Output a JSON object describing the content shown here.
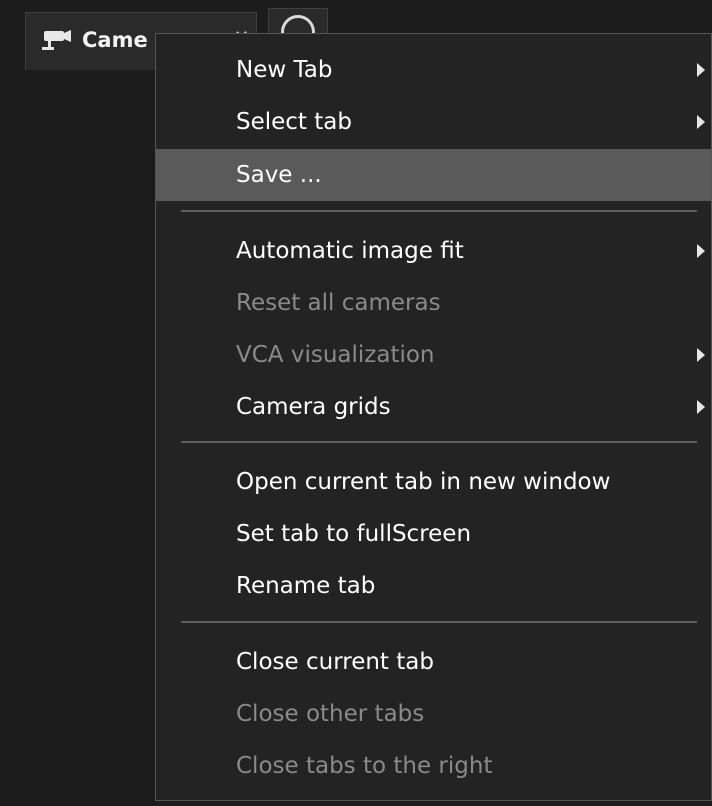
{
  "tab": {
    "label": "Came",
    "close_icon": "close-icon",
    "camera_icon": "camera-icon"
  },
  "add_tab": {
    "icon": "plus-circle-icon"
  },
  "menu": {
    "items": [
      {
        "label": "New Tab",
        "enabled": true,
        "submenu": true
      },
      {
        "label": "Select tab",
        "enabled": true,
        "submenu": true
      },
      {
        "label": "Save ...",
        "enabled": true,
        "submenu": false,
        "highlighted": true
      },
      {
        "label": "Automatic image fit",
        "enabled": true,
        "submenu": true
      },
      {
        "label": "Reset all cameras",
        "enabled": false,
        "submenu": false
      },
      {
        "label": "VCA visualization",
        "enabled": false,
        "submenu": true
      },
      {
        "label": "Camera grids",
        "enabled": true,
        "submenu": true
      },
      {
        "label": "Open current tab in new window",
        "enabled": true,
        "submenu": false
      },
      {
        "label": "Set tab to fullScreen",
        "enabled": true,
        "submenu": false
      },
      {
        "label": "Rename tab",
        "enabled": true,
        "submenu": false
      },
      {
        "label": "Close current tab",
        "enabled": true,
        "submenu": false
      },
      {
        "label": "Close other tabs",
        "enabled": false,
        "submenu": false
      },
      {
        "label": "Close tabs to the right",
        "enabled": false,
        "submenu": false
      }
    ]
  },
  "colors": {
    "background": "#1c1c1c",
    "menu_background": "#232323",
    "highlight": "#5a5a5a",
    "enabled_text": "#ffffff",
    "disabled_text": "#8a8a8a"
  }
}
